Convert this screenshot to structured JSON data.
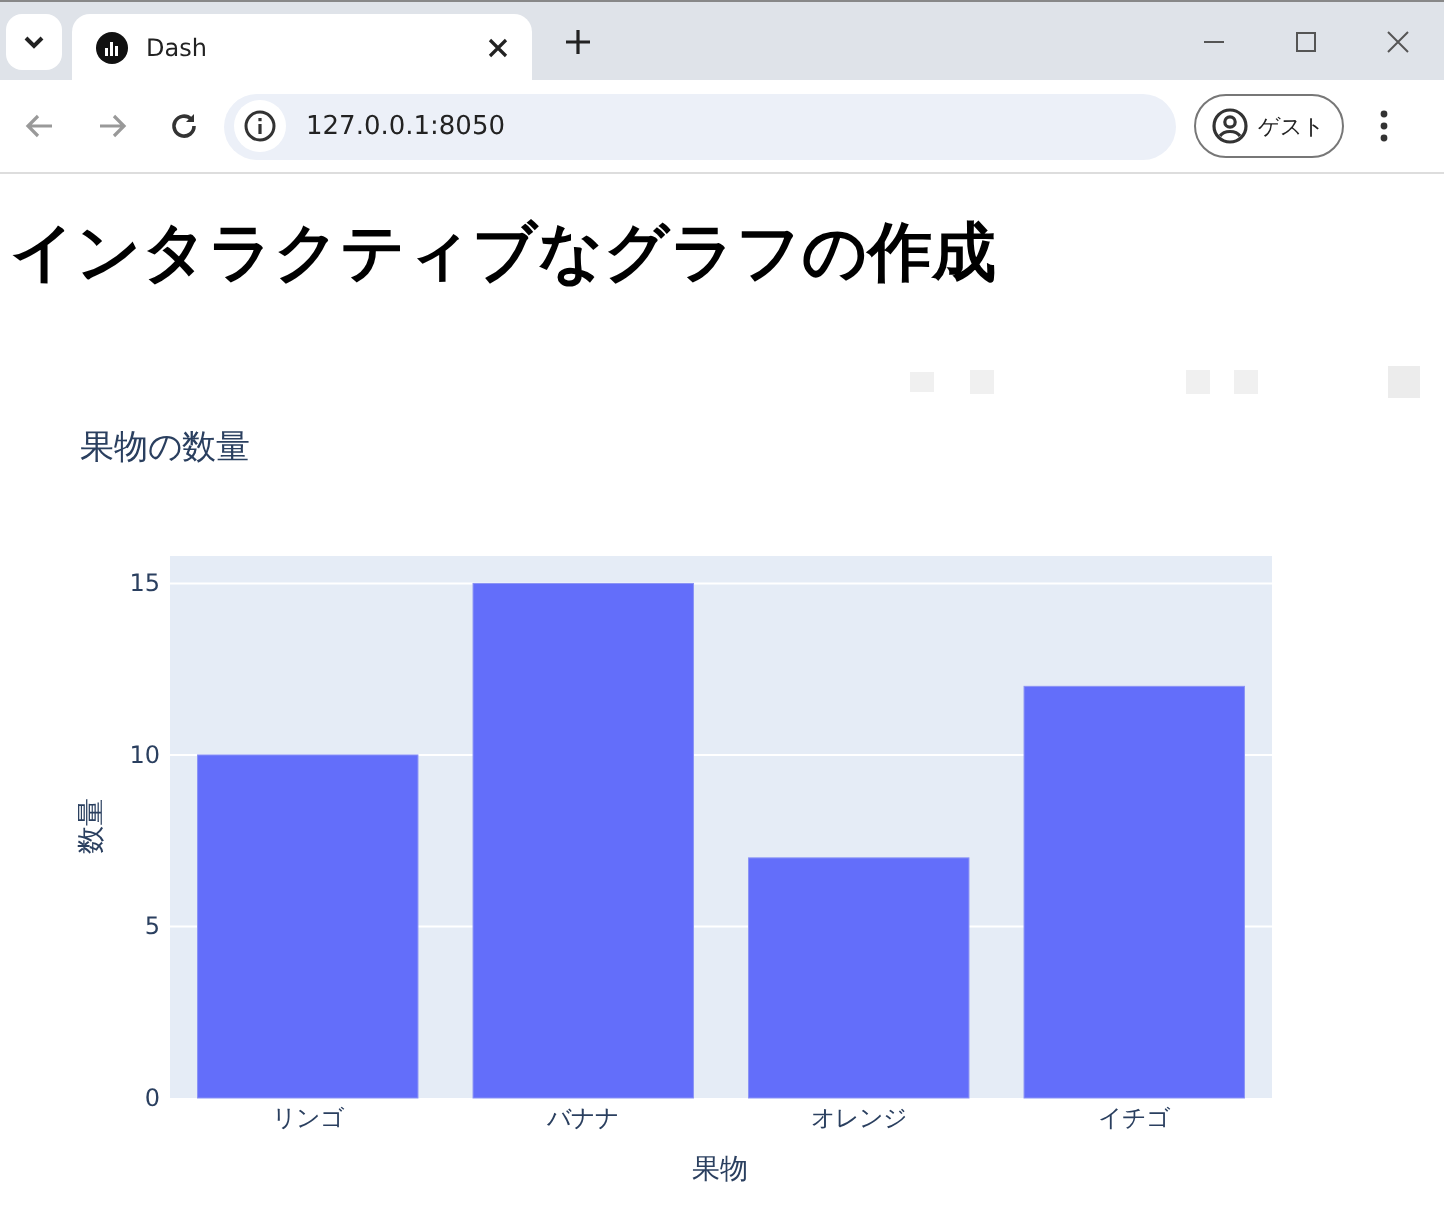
{
  "browser": {
    "tab_title": "Dash",
    "url": "127.0.0.1:8050",
    "profile_label": "ゲスト"
  },
  "heading": "インタラクティブなグラフの作成",
  "chart": {
    "chart_data": {
      "type": "bar",
      "title": "果物の数量",
      "xlabel": "果物",
      "ylabel": "数量",
      "categories": [
        "リンゴ",
        "バナナ",
        "オレンジ",
        "イチゴ"
      ],
      "series": [
        {
          "color": "#636efa",
          "values": [
            10,
            15,
            7,
            12
          ]
        }
      ],
      "grid": true,
      "ylim": [
        0,
        15.8
      ],
      "yticks": [
        0,
        5,
        10,
        15
      ]
    }
  }
}
